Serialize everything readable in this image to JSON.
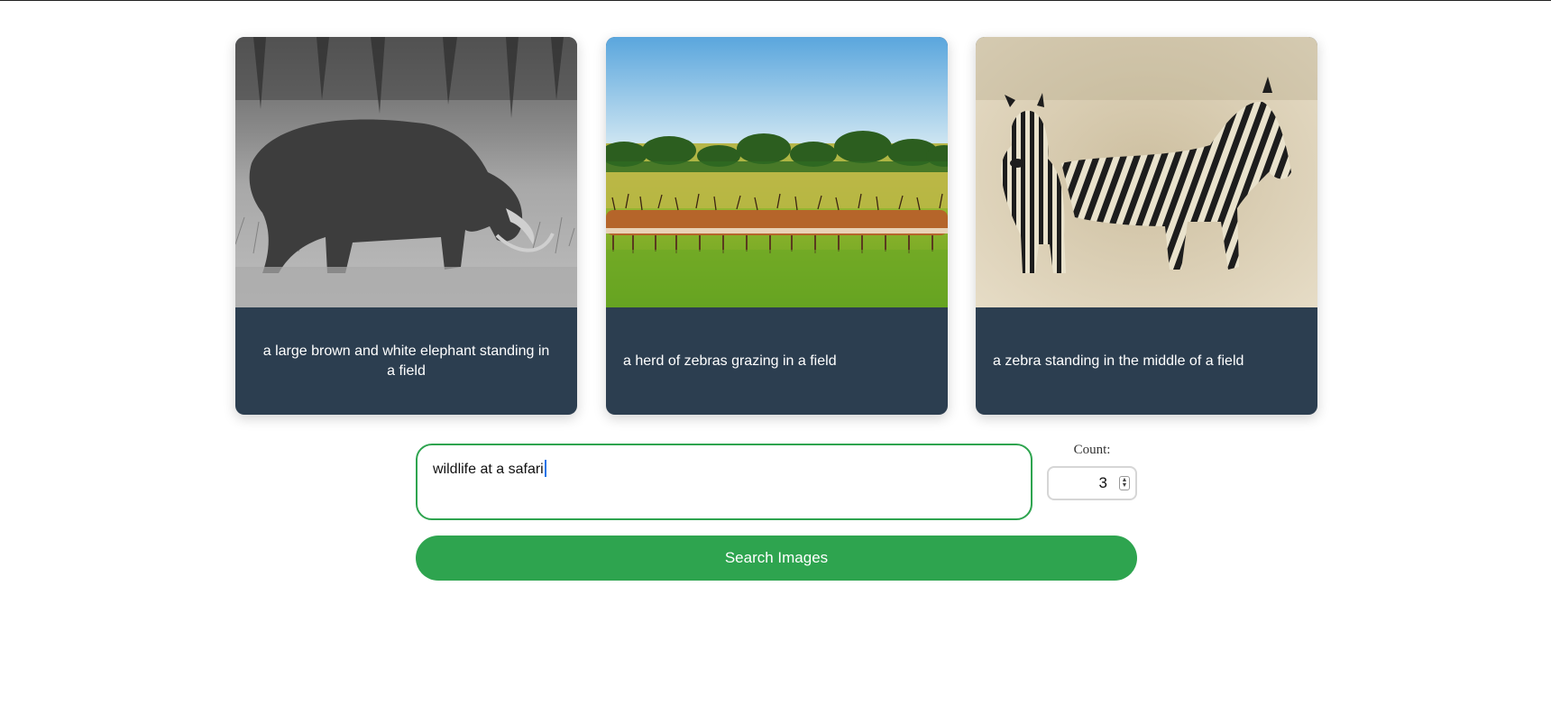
{
  "results": [
    {
      "caption": "a large brown and white elephant standing in a field",
      "image": "grayscale photo of a rhinoceros grazing in tall grass"
    },
    {
      "caption": "a herd of zebras grazing in a field",
      "image": "herd of impala in a green savanna under blue sky"
    },
    {
      "caption": "a zebra standing in the middle of a field",
      "image": "two zebras standing in a sepia-toned field"
    }
  ],
  "search": {
    "query": "wildlife at a safari",
    "count_label": "Count:",
    "count_value": "3",
    "button_label": "Search Images"
  },
  "colors": {
    "accent": "#2ea44f",
    "caption_bg": "#2c3e50"
  }
}
